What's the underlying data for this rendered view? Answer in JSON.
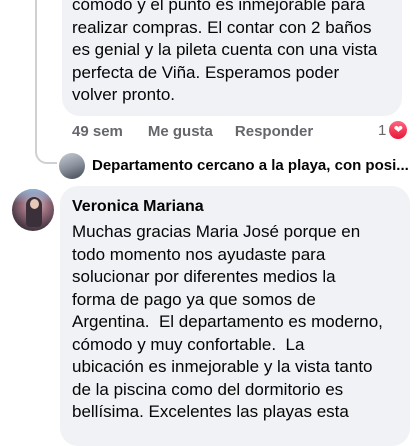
{
  "previous_comment": {
    "text_lines": [
      "cómodo y el punto es inmejorable para",
      "realizar compras. El contar con 2 baños",
      "es genial y la pileta cuenta con una vista",
      "perfecta de Viña. Esperamos poder",
      "volver pronto."
    ],
    "time": "49 sem",
    "like_label": "Me gusta",
    "reply_label": "Responder",
    "reaction_count": "1",
    "reaction_icon": "heart-icon",
    "reaction_color": "#f0284a"
  },
  "post_reference": {
    "title": "Departamento cercano a la playa, con posi...",
    "trailing": "..."
  },
  "comment": {
    "author": "Veronica Mariana",
    "text_lines": [
      "Muchas gracias Maria José porque en",
      "todo momento nos ayudaste para",
      "solucionar por diferentes medios la",
      "forma de pago ya que somos de",
      "Argentina.  El departamento es moderno,",
      "cómodo y muy confortable.  La",
      "ubicación es inmejorable y la vista tanto",
      "de la piscina como del dormitorio es",
      "bellísima. Excelentes las playas esta"
    ]
  },
  "colors": {
    "bubble": "#f0f2f5",
    "secondary_text": "#65676b",
    "primary_text": "#050505"
  }
}
